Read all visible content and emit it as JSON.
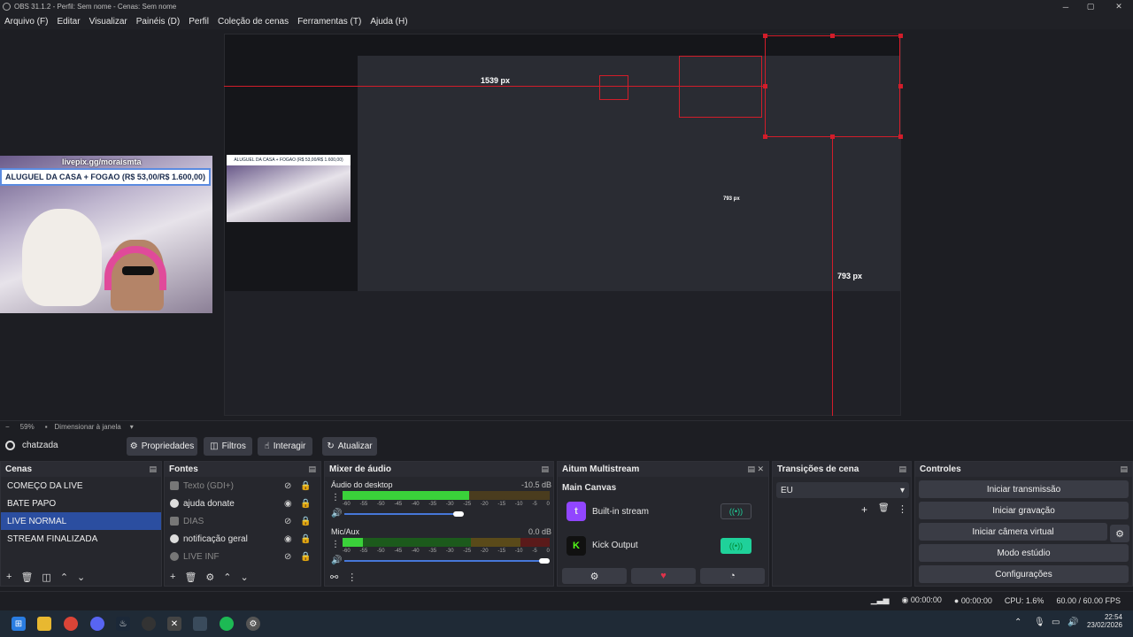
{
  "window": {
    "title": "OBS 31.1.2 - Perfil: Sem nome - Cenas: Sem nome"
  },
  "menu": [
    "Arquivo (F)",
    "Editar",
    "Visualizar",
    "Painéis (D)",
    "Perfil",
    "Coleção de cenas",
    "Ferramentas (T)",
    "Ajuda (H)"
  ],
  "preview": {
    "url_text": "livepix.gg/moraismta",
    "banner_text": "ALUGUEL DA CASA + FOGAO (R$ 53,00/R$ 1.600,00)",
    "measure_w": "1539 px",
    "measure_h": "793 px",
    "measure_h2": "793 px"
  },
  "zoom": {
    "value": "59%",
    "mode": "Dimensionar à janela"
  },
  "scene_toolbar": {
    "source_name": "chatzada",
    "properties": "Propriedades",
    "filters": "Filtros",
    "interact": "Interagir",
    "refresh": "Atualizar"
  },
  "scenes": {
    "title": "Cenas",
    "items": [
      "COMEÇO DA LIVE",
      "BATE PAPO",
      "LIVE NORMAL",
      "STREAM FINALIZADA"
    ],
    "selected": "LIVE NORMAL"
  },
  "sources": {
    "title": "Fontes",
    "items": [
      {
        "name": "Texto (GDI+)",
        "visible": false
      },
      {
        "name": "ajuda donate",
        "visible": true
      },
      {
        "name": "DIAS",
        "visible": false
      },
      {
        "name": "notificação geral",
        "visible": true
      },
      {
        "name": "LIVE INF",
        "visible": false
      }
    ]
  },
  "mixer": {
    "title": "Mixer de áudio",
    "channels": [
      {
        "name": "Áudio do desktop",
        "db": "-10.5 dB",
        "level": 0.61,
        "volume": 0.58
      },
      {
        "name": "Mic/Aux",
        "db": "0.0 dB",
        "level": 0.1,
        "volume": 1.0
      }
    ],
    "ticks": [
      "-60",
      "-55",
      "-50",
      "-45",
      "-40",
      "-35",
      "-30",
      "-25",
      "-20",
      "-15",
      "-10",
      "-5",
      "0"
    ]
  },
  "multistream": {
    "title": "Aitum Multistream",
    "canvas": "Main Canvas",
    "outputs": [
      {
        "name": "Built-in stream",
        "icon": "twitch-icon",
        "active": false
      },
      {
        "name": "Kick Output",
        "icon": "kick-icon",
        "active": true
      }
    ]
  },
  "transitions": {
    "title": "Transições de cena",
    "selected": "EU"
  },
  "controls": {
    "title": "Controles",
    "buttons": [
      "Iniciar transmissão",
      "Iniciar gravação",
      "Iniciar câmera virtual",
      "Modo estúdio",
      "Configurações"
    ]
  },
  "status": {
    "stream_time": "00:00:00",
    "rec_time": "00:00:00",
    "cpu": "CPU: 1.6%",
    "fps": "60.00 / 60.00 FPS"
  },
  "clock": {
    "time": "22:54",
    "date": "23/02/2026"
  },
  "colors": {
    "accent": "#2b4ea0",
    "red": "#d21d2a",
    "green": "#1fd19a"
  }
}
